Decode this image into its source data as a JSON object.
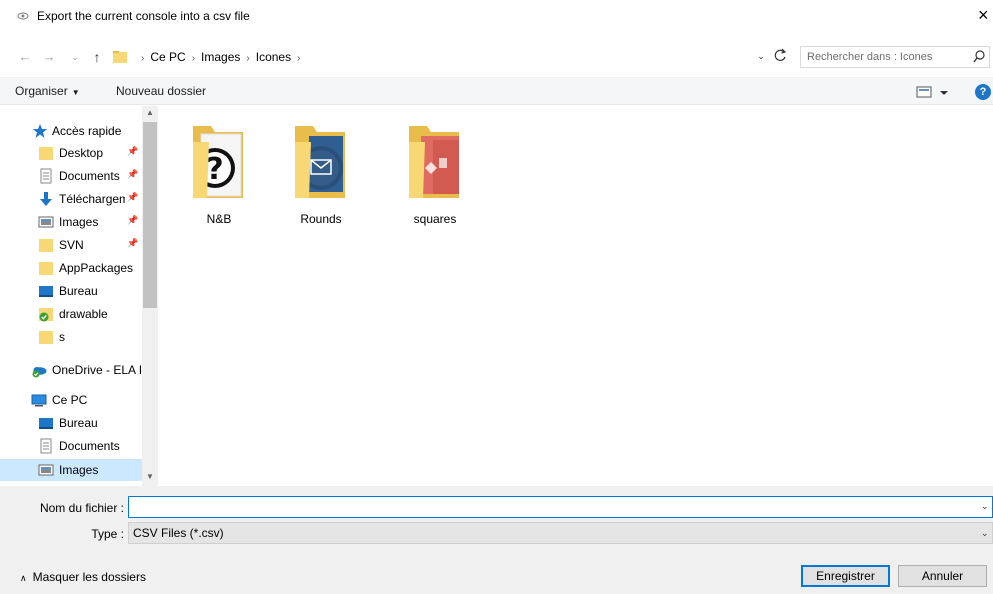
{
  "window": {
    "title": "Export the current console into a csv file",
    "close_label": "×"
  },
  "address": {
    "crumbs": [
      "Ce PC",
      "Images",
      "Icones"
    ],
    "trailing_sep": "›"
  },
  "search": {
    "placeholder": "Rechercher dans : Icones"
  },
  "toolbar": {
    "organiser_label": "Organiser",
    "nouveau_label": "Nouveau dossier",
    "help_label": "?"
  },
  "sidebar": {
    "items": [
      {
        "label": "Accès rapide",
        "icon": "star-icon"
      },
      {
        "label": "Desktop",
        "icon": "folder-icon",
        "pinned": true
      },
      {
        "label": "Documents",
        "icon": "document-icon",
        "pinned": true
      },
      {
        "label": "Téléchargements",
        "icon": "download-icon",
        "pinned": true
      },
      {
        "label": "Images",
        "icon": "pictures-icon",
        "pinned": true
      },
      {
        "label": "SVN",
        "icon": "folder-icon",
        "pinned": true
      },
      {
        "label": "AppPackages",
        "icon": "folder-icon"
      },
      {
        "label": "Bureau",
        "icon": "desktop-icon"
      },
      {
        "label": "drawable",
        "icon": "svn-folder-icon"
      },
      {
        "label": "s",
        "icon": "folder-icon"
      },
      {
        "label": "OneDrive - ELA In",
        "icon": "onedrive-icon"
      },
      {
        "label": "Ce PC",
        "icon": "computer-icon"
      },
      {
        "label": "Bureau",
        "icon": "desktop-icon"
      },
      {
        "label": "Documents",
        "icon": "document-icon"
      },
      {
        "label": "Images",
        "icon": "pictures-icon"
      }
    ]
  },
  "files": [
    {
      "name": "N&B"
    },
    {
      "name": "Rounds"
    },
    {
      "name": "squares"
    }
  ],
  "form": {
    "filename_label": "Nom du fichier :",
    "filename_value": "",
    "type_label": "Type :",
    "type_value": "CSV Files  (*.csv)",
    "hide_folders_label": "Masquer les dossiers",
    "save_label": "Enregistrer",
    "cancel_label": "Annuler"
  },
  "colors": {
    "accent": "#0078d7",
    "folder": "#f8d775",
    "selected": "#cce8ff"
  }
}
